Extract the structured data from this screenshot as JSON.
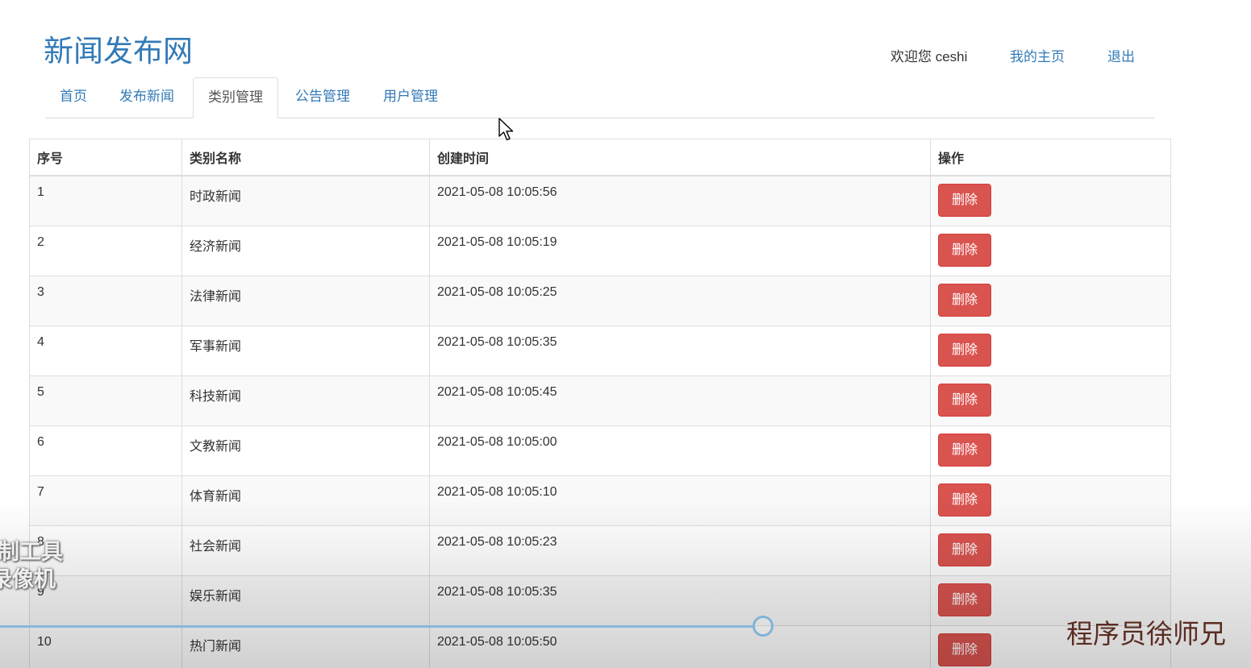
{
  "site": {
    "title": "新闻发布网"
  },
  "user_bar": {
    "welcome": "欢迎您 ceshi",
    "my_home": "我的主页",
    "logout": "退出"
  },
  "nav": {
    "tabs": [
      {
        "label": "首页",
        "active": false
      },
      {
        "label": "发布新闻",
        "active": false
      },
      {
        "label": "类别管理",
        "active": true
      },
      {
        "label": "公告管理",
        "active": false
      },
      {
        "label": "用户管理",
        "active": false
      }
    ]
  },
  "table": {
    "headers": [
      "序号",
      "类别名称",
      "创建时间",
      "操作"
    ],
    "delete_label": "删除",
    "rows": [
      {
        "id": "1",
        "name": "时政新闻",
        "created": "2021-05-08 10:05:56"
      },
      {
        "id": "2",
        "name": "经济新闻",
        "created": "2021-05-08 10:05:19"
      },
      {
        "id": "3",
        "name": "法律新闻",
        "created": "2021-05-08 10:05:25"
      },
      {
        "id": "4",
        "name": "军事新闻",
        "created": "2021-05-08 10:05:35"
      },
      {
        "id": "5",
        "name": "科技新闻",
        "created": "2021-05-08 10:05:45"
      },
      {
        "id": "6",
        "name": "文教新闻",
        "created": "2021-05-08 10:05:00"
      },
      {
        "id": "7",
        "name": "体育新闻",
        "created": "2021-05-08 10:05:10"
      },
      {
        "id": "8",
        "name": "社会新闻",
        "created": "2021-05-08 10:05:23"
      },
      {
        "id": "9",
        "name": "娱乐新闻",
        "created": "2021-05-08 10:05:35"
      },
      {
        "id": "10",
        "name": "热门新闻",
        "created": "2021-05-08 10:05:50"
      }
    ]
  },
  "overlay": {
    "left_watermark_line1": "录制工具",
    "left_watermark_line2": "X录像机",
    "right_watermark": "程序员徐师兄"
  },
  "colors": {
    "link": "#337ab7",
    "danger": "#d9534f",
    "border": "#dddddd",
    "stripe": "#f9f9f9"
  }
}
